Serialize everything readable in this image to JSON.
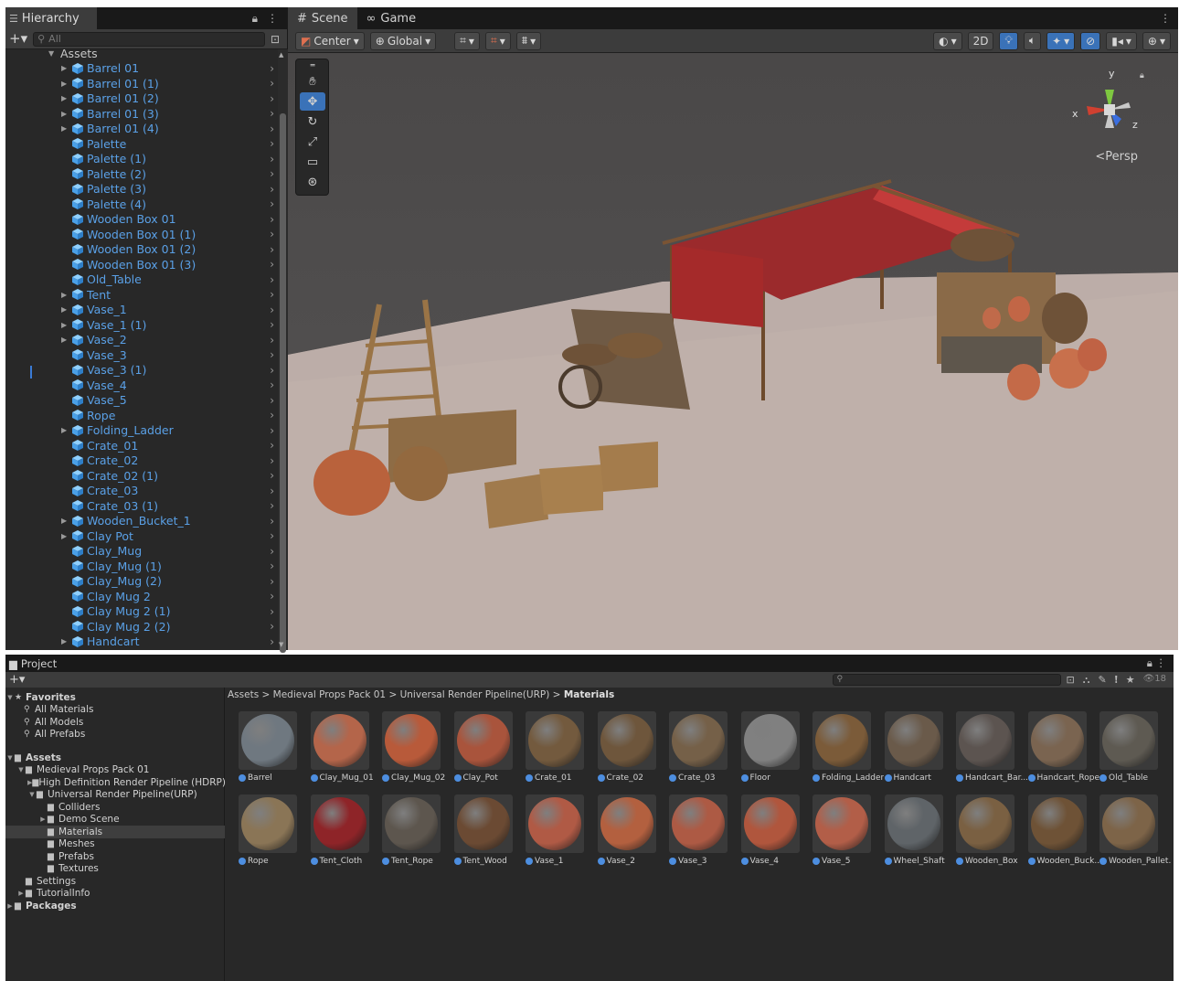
{
  "hierarchy": {
    "tab_label": "Hierarchy",
    "search_placeholder": "All",
    "root_label": "Assets",
    "items": [
      {
        "label": "Barrel 01",
        "expandable": true
      },
      {
        "label": "Barrel 01 (1)",
        "expandable": true
      },
      {
        "label": "Barrel 01 (2)",
        "expandable": true
      },
      {
        "label": "Barrel 01 (3)",
        "expandable": true
      },
      {
        "label": "Barrel 01 (4)",
        "expandable": true
      },
      {
        "label": "Palette",
        "expandable": false
      },
      {
        "label": "Palette (1)",
        "expandable": false
      },
      {
        "label": "Palette (2)",
        "expandable": false
      },
      {
        "label": "Palette (3)",
        "expandable": false
      },
      {
        "label": "Palette (4)",
        "expandable": false
      },
      {
        "label": "Wooden Box 01",
        "expandable": false
      },
      {
        "label": "Wooden Box 01 (1)",
        "expandable": false
      },
      {
        "label": "Wooden Box 01 (2)",
        "expandable": false
      },
      {
        "label": "Wooden Box 01 (3)",
        "expandable": false
      },
      {
        "label": "Old_Table",
        "expandable": false
      },
      {
        "label": "Tent",
        "expandable": true
      },
      {
        "label": "Vase_1",
        "expandable": true
      },
      {
        "label": "Vase_1 (1)",
        "expandable": true
      },
      {
        "label": "Vase_2",
        "expandable": true
      },
      {
        "label": "Vase_3",
        "expandable": false
      },
      {
        "label": "Vase_3 (1)",
        "expandable": false
      },
      {
        "label": "Vase_4",
        "expandable": false
      },
      {
        "label": "Vase_5",
        "expandable": false
      },
      {
        "label": "Rope",
        "expandable": false
      },
      {
        "label": "Folding_Ladder",
        "expandable": true
      },
      {
        "label": "Crate_01",
        "expandable": false
      },
      {
        "label": "Crate_02",
        "expandable": false
      },
      {
        "label": "Crate_02 (1)",
        "expandable": false
      },
      {
        "label": "Crate_03",
        "expandable": false
      },
      {
        "label": "Crate_03 (1)",
        "expandable": false
      },
      {
        "label": "Wooden_Bucket_1",
        "expandable": true
      },
      {
        "label": "Clay Pot",
        "expandable": true
      },
      {
        "label": "Clay_Mug",
        "expandable": false
      },
      {
        "label": "Clay_Mug (1)",
        "expandable": false
      },
      {
        "label": "Clay_Mug (2)",
        "expandable": false
      },
      {
        "label": "Clay Mug 2",
        "expandable": false
      },
      {
        "label": "Clay Mug 2 (1)",
        "expandable": false
      },
      {
        "label": "Clay Mug 2 (2)",
        "expandable": false
      },
      {
        "label": "Handcart",
        "expandable": true
      }
    ]
  },
  "scene": {
    "tabs": [
      {
        "label": "Scene",
        "icon": "grid-icon"
      },
      {
        "label": "Game",
        "icon": "gamepad-icon"
      }
    ],
    "pivot_label": "Center",
    "space_label": "Global",
    "mode_2d_label": "2D",
    "axis_x": "x",
    "axis_y": "y",
    "axis_z": "z",
    "projection_label": "Persp"
  },
  "project": {
    "tab_label": "Project",
    "asset_count": "18",
    "favorites": {
      "label": "Favorites",
      "items": [
        "All Materials",
        "All Models",
        "All Prefabs"
      ]
    },
    "tree": [
      {
        "label": "Assets",
        "depth": 0,
        "bold": true,
        "arrow": "▼"
      },
      {
        "label": "Medieval Props Pack 01",
        "depth": 1,
        "arrow": "▼"
      },
      {
        "label": "High Definition Render Pipeline (HDRP)",
        "depth": 2,
        "arrow": "▶"
      },
      {
        "label": "Universal Render Pipeline(URP)",
        "depth": 2,
        "arrow": "▼"
      },
      {
        "label": "Colliders",
        "depth": 3,
        "arrow": ""
      },
      {
        "label": "Demo Scene",
        "depth": 3,
        "arrow": "▶"
      },
      {
        "label": "Materials",
        "depth": 3,
        "arrow": "",
        "selected": true
      },
      {
        "label": "Meshes",
        "depth": 3,
        "arrow": ""
      },
      {
        "label": "Prefabs",
        "depth": 3,
        "arrow": ""
      },
      {
        "label": "Textures",
        "depth": 3,
        "arrow": ""
      },
      {
        "label": "Settings",
        "depth": 1,
        "arrow": ""
      },
      {
        "label": "TutorialInfo",
        "depth": 1,
        "arrow": "▶"
      },
      {
        "label": "Packages",
        "depth": 0,
        "bold": true,
        "arrow": "▶"
      }
    ],
    "breadcrumb": [
      "Assets",
      "Medieval Props Pack 01",
      "Universal Render Pipeline(URP)",
      "Materials"
    ],
    "materials": [
      {
        "name": "Barrel",
        "color": "#6f7880"
      },
      {
        "name": "Clay_Mug_01",
        "color": "#b4654a"
      },
      {
        "name": "Clay_Mug_02",
        "color": "#b85a3a"
      },
      {
        "name": "Clay_Pot",
        "color": "#a9543c"
      },
      {
        "name": "Crate_01",
        "color": "#735a3e"
      },
      {
        "name": "Crate_02",
        "color": "#6e563c"
      },
      {
        "name": "Crate_03",
        "color": "#756048"
      },
      {
        "name": "Floor",
        "color": "#808080"
      },
      {
        "name": "Folding_Ladder",
        "color": "#7b5b39"
      },
      {
        "name": "Handcart",
        "color": "#6a5a4a"
      },
      {
        "name": "Handcart_Bar...",
        "color": "#5c5450"
      },
      {
        "name": "Handcart_Rope",
        "color": "#7a6450"
      },
      {
        "name": "Old_Table",
        "color": "#5e5a52"
      },
      {
        "name": "Rope",
        "color": "#8a7556"
      },
      {
        "name": "Tent_Cloth",
        "color": "#8e2428"
      },
      {
        "name": "Tent_Rope",
        "color": "#5d564e"
      },
      {
        "name": "Tent_Wood",
        "color": "#6b4a33"
      },
      {
        "name": "Vase_1",
        "color": "#b05a45"
      },
      {
        "name": "Vase_2",
        "color": "#b3603f"
      },
      {
        "name": "Vase_3",
        "color": "#ad5a44"
      },
      {
        "name": "Vase_4",
        "color": "#b0563d"
      },
      {
        "name": "Vase_5",
        "color": "#b25e48"
      },
      {
        "name": "Wheel_Shaft",
        "color": "#5f6468"
      },
      {
        "name": "Wooden_Box",
        "color": "#7a6042"
      },
      {
        "name": "Wooden_Buck...",
        "color": "#6e5236"
      },
      {
        "name": "Wooden_Pallet...",
        "color": "#7d6448"
      }
    ]
  }
}
